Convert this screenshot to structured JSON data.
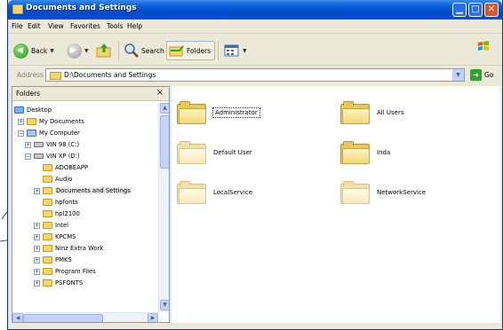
{
  "window": {
    "title": "Documents and Settings",
    "controls": {
      "minimize": "▁",
      "maximize": "□",
      "close": "✕"
    }
  },
  "menu": [
    "File",
    "Edit",
    "View",
    "Favorites",
    "Tools",
    "Help"
  ],
  "toolbar": {
    "back": "Back",
    "search": "Search",
    "folders": "Folders"
  },
  "address": {
    "label": "Address",
    "value": "D:\\Documents and Settings",
    "go": "Go"
  },
  "folders_pane": {
    "title": "Folders",
    "close": "×",
    "tree": [
      {
        "label": "Desktop",
        "icon": "desktop-icon"
      },
      {
        "label": "My Documents",
        "icon": "my-documents-icon"
      },
      {
        "label": "My Computer",
        "icon": "my-computer-icon"
      },
      {
        "label": "VIN 98 (C:)",
        "icon": "drive-icon"
      },
      {
        "label": "VIN XP (D:)",
        "icon": "drive-icon"
      },
      {
        "label": "ADOBEAPP",
        "icon": "folder-icon"
      },
      {
        "label": "Audio",
        "icon": "folder-icon"
      },
      {
        "label": "Documents and Settings",
        "icon": "folder-icon"
      },
      {
        "label": "hpfonts",
        "icon": "folder-icon"
      },
      {
        "label": "hpl2100",
        "icon": "folder-icon"
      },
      {
        "label": "Intel",
        "icon": "folder-icon"
      },
      {
        "label": "KPCMS",
        "icon": "folder-icon"
      },
      {
        "label": "Ninz Extra Work",
        "icon": "folder-icon"
      },
      {
        "label": "PMKS",
        "icon": "folder-icon"
      },
      {
        "label": "Program Files",
        "icon": "folder-icon"
      },
      {
        "label": "PSFONTS",
        "icon": "folder-icon"
      }
    ]
  },
  "content": {
    "items": [
      {
        "label": "Administrator",
        "selected": true
      },
      {
        "label": "All Users",
        "selected": false
      },
      {
        "label": "Default User",
        "selected": false
      },
      {
        "label": "Inda",
        "selected": false
      },
      {
        "label": "LocalService",
        "selected": false
      },
      {
        "label": "NetworkService",
        "selected": false
      }
    ]
  }
}
